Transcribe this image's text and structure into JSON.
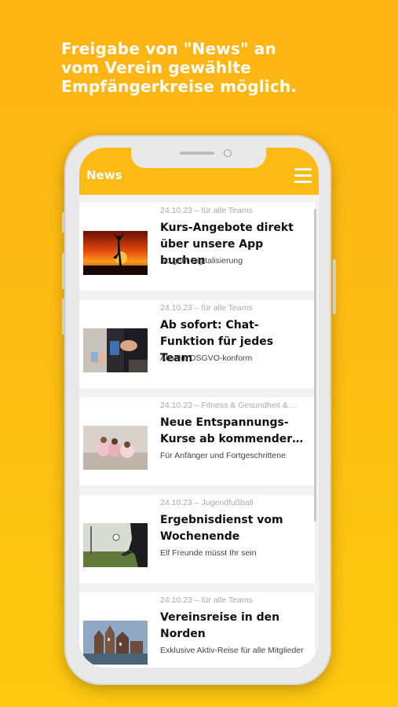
{
  "promo": {
    "line1": "Freigabe von \"News\" an",
    "line2": "vom Verein gewählte",
    "line3": "Empfängerkreise möglich."
  },
  "app": {
    "title": "News",
    "menu_icon": "hamburger-menu-icon"
  },
  "news": [
    {
      "meta": "24.10.23 – für alle Teams",
      "title": "Kurs-Angebote direkt über unsere App buchen",
      "subtitle": "So geht Digitalisierung",
      "image": "yoga-sunset-photo"
    },
    {
      "meta": "24.10.23 – für alle Teams",
      "title": "Ab sofort: Chat-Funktion für jedes Team",
      "subtitle": "Absolut DSGVO-konform",
      "image": "smartphones-hands-photo"
    },
    {
      "meta": "24.10.23 – Fitness & Gesundheit & ...",
      "title": "Neue Entspannungs-Kurse ab kommender…",
      "subtitle": "Für Anfänger und Fortgeschrittene",
      "image": "relaxation-class-photo"
    },
    {
      "meta": "24.10.23 – Jugendfußball",
      "title": "Ergebnisdienst vom Wochenende",
      "subtitle": "Elf Freunde müsst Ihr sein",
      "image": "football-kick-photo"
    },
    {
      "meta": "24.10.23 – für alle Teams",
      "title": "Vereinsreise in den Norden",
      "subtitle": "Exklusive Aktiv-Reise für alle Mitglieder",
      "image": "northern-city-photo"
    }
  ]
}
